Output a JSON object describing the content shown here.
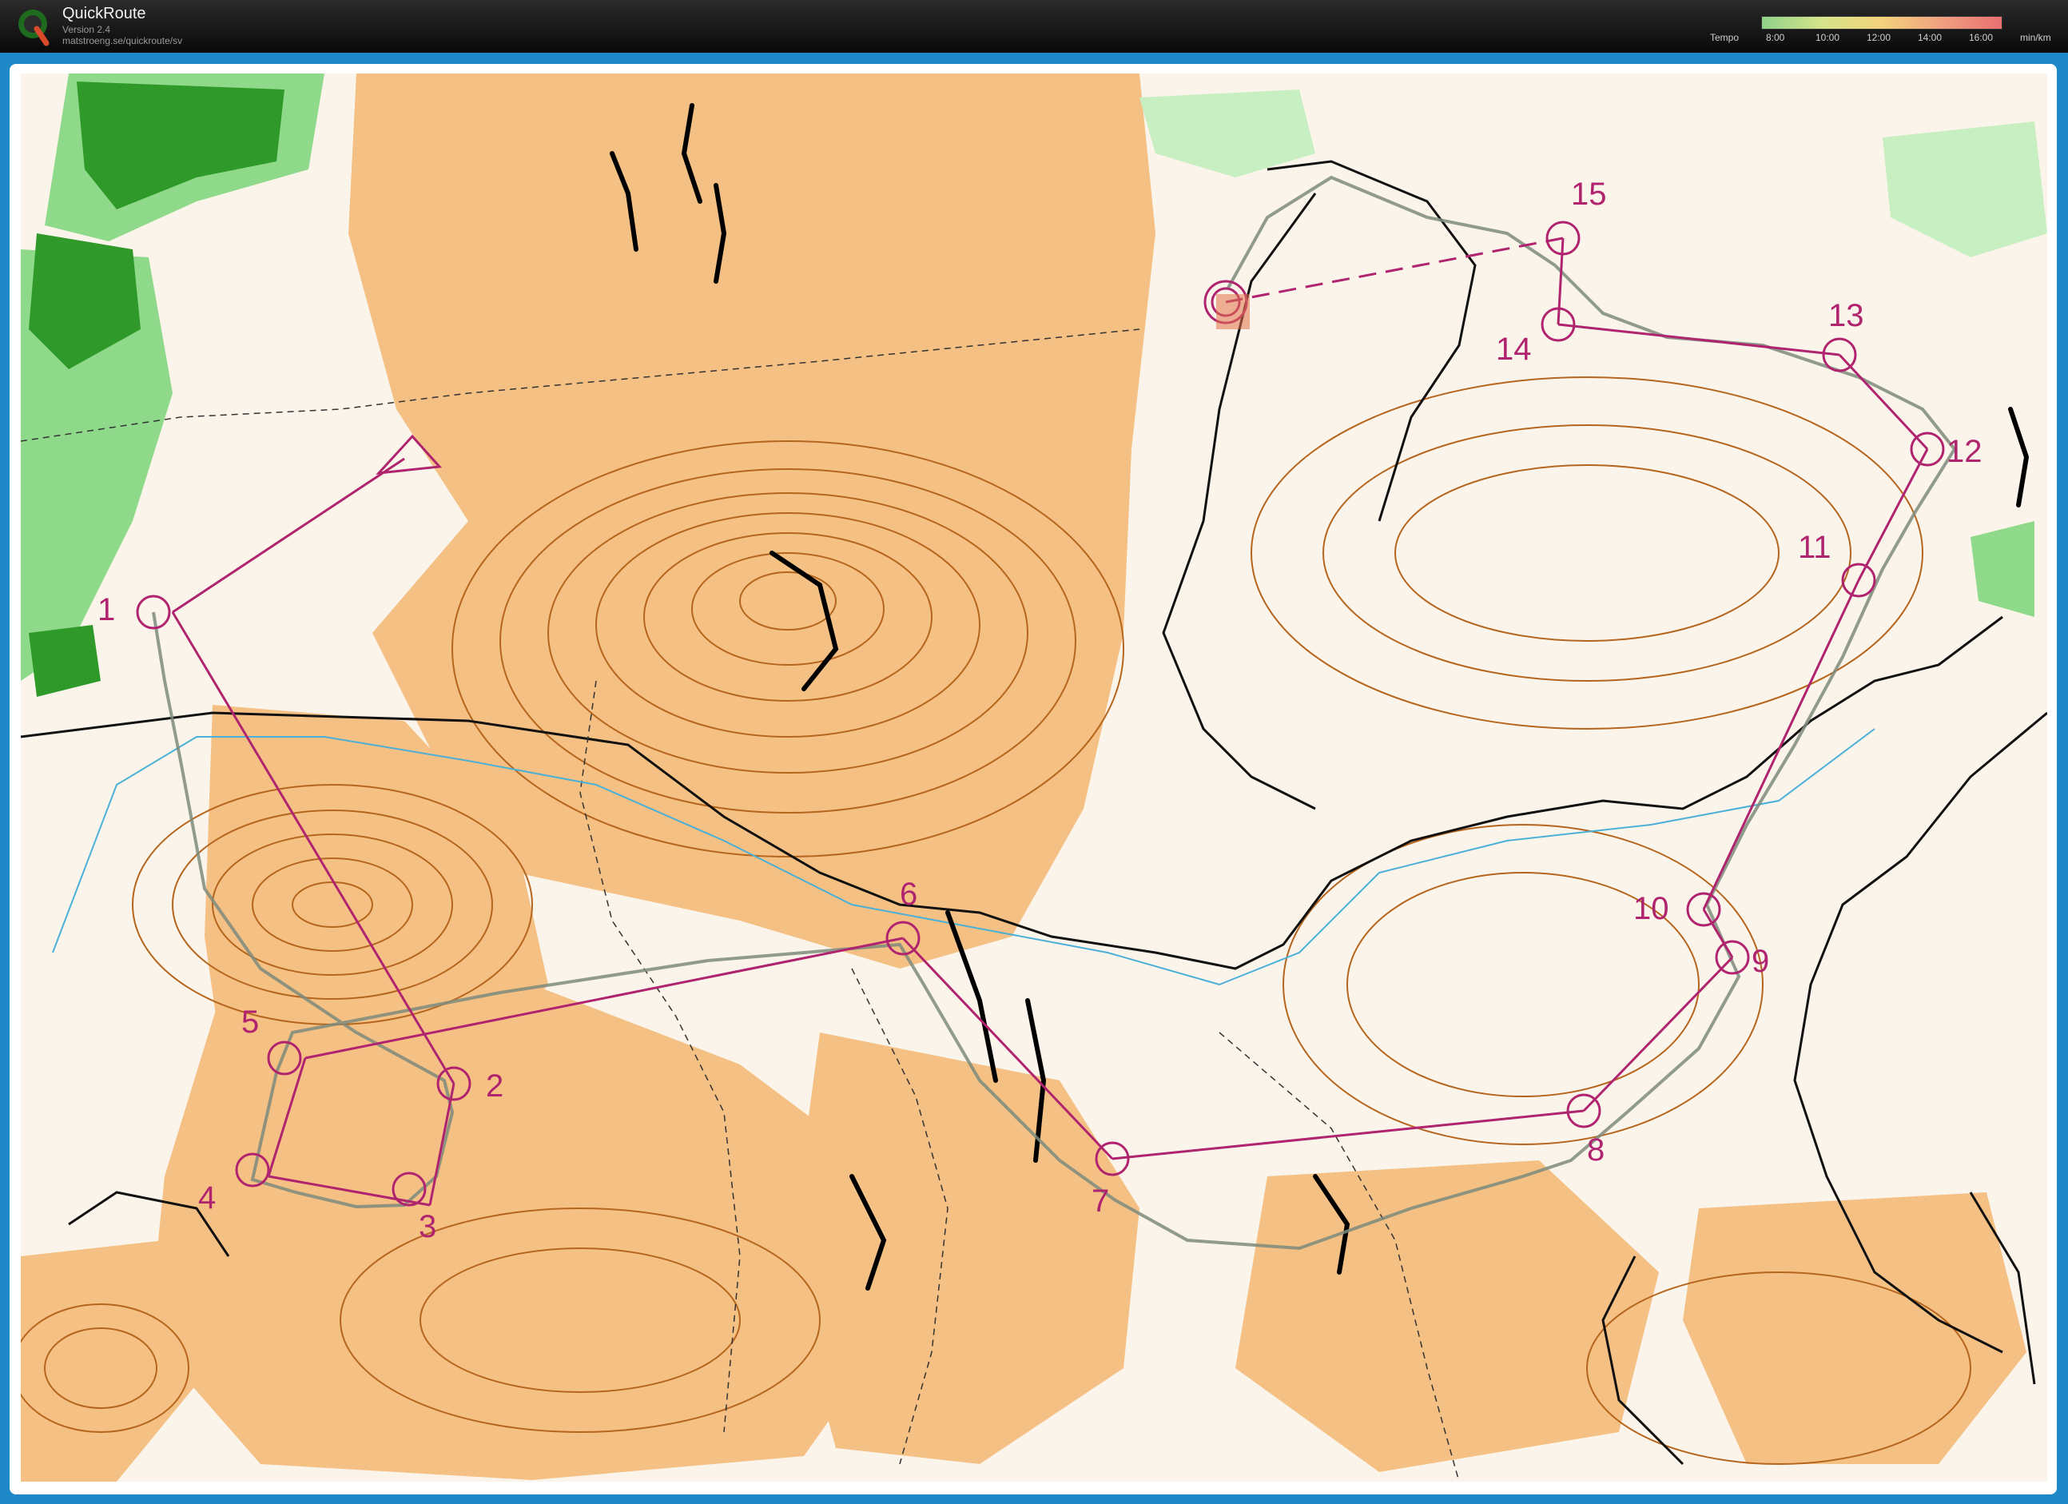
{
  "app": {
    "title": "QuickRoute",
    "version": "Version 2.4",
    "url": "matstroeng.se/quickroute/sv"
  },
  "legend": {
    "label": "Tempo",
    "ticks": [
      "8:00",
      "10:00",
      "12:00",
      "14:00",
      "16:00"
    ],
    "unit": "min/km",
    "colors": [
      "#8fd18a",
      "#d6e48a",
      "#f3d37c",
      "#f0a080",
      "#e87070"
    ]
  },
  "map": {
    "course_color": "#b0246f",
    "controls": [
      "1",
      "2",
      "3",
      "4",
      "5",
      "6",
      "7",
      "8",
      "9",
      "10",
      "11",
      "12",
      "13",
      "14",
      "15"
    ]
  }
}
